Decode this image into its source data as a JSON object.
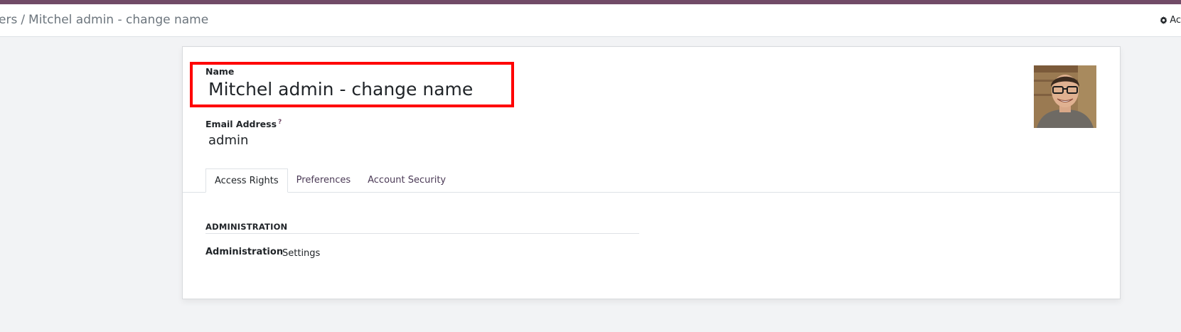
{
  "breadcrumb": {
    "parent_label": "ers",
    "separator": "/",
    "current_label": "Mitchel admin - change name"
  },
  "action_menu": {
    "label": "Ac",
    "icon": "gear-icon"
  },
  "form": {
    "name_label": "Name",
    "name_value": "Mitchel admin - change name",
    "email_label": "Email Address",
    "email_help_marker": "?",
    "email_value": "admin",
    "avatar_icon": "user-photo"
  },
  "tabs": [
    {
      "label": "Access Rights",
      "active": true
    },
    {
      "label": "Preferences",
      "active": false
    },
    {
      "label": "Account Security",
      "active": false
    }
  ],
  "access_rights": {
    "group_title": "ADMINISTRATION",
    "field_label": "Administration",
    "field_value": "Settings"
  },
  "colors": {
    "brand": "#714b67",
    "highlight": "#ff0000",
    "background": "#f2f3f5"
  }
}
